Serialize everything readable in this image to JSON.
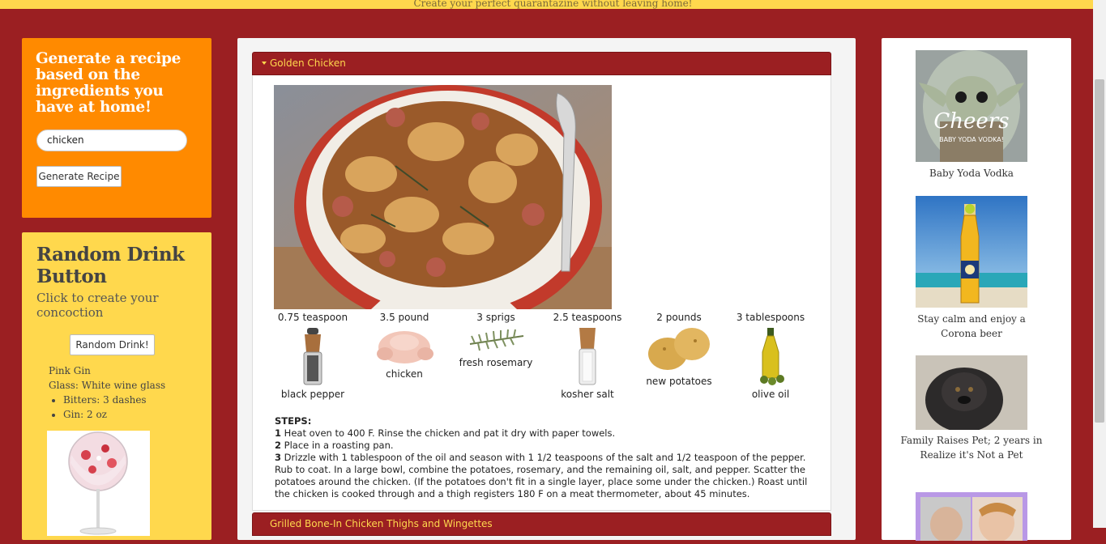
{
  "banner": {
    "tagline": "Create your perfect quarantazine without leaving home!"
  },
  "generator": {
    "title": "Generate a recipe based on the ingredients you have at home!",
    "input_value": "chicken",
    "button_label": "Generate Recipe"
  },
  "random_drink": {
    "title": "Random Drink Button",
    "subtitle": "Click to create your concoction",
    "button_label": "Random Drink!",
    "drink_name": "Pink Gin",
    "glass": "Glass: White wine glass",
    "ingredients": [
      "Bitters: 3 dashes",
      "Gin: 2 oz"
    ]
  },
  "recipes": [
    {
      "title": "Golden Chicken",
      "expanded": true,
      "ingredients": [
        {
          "qty": "0.75 teaspoon",
          "name": "black pepper",
          "icon": "pepper-grinder-icon"
        },
        {
          "qty": "3.5 pound",
          "name": "chicken",
          "icon": "raw-chicken-icon"
        },
        {
          "qty": "3 sprigs",
          "name": "fresh rosemary",
          "icon": "rosemary-icon"
        },
        {
          "qty": "2.5 teaspoons",
          "name": "kosher salt",
          "icon": "salt-grinder-icon"
        },
        {
          "qty": "2 pounds",
          "name": "new potatoes",
          "icon": "potatoes-icon"
        },
        {
          "qty": "3 tablespoons",
          "name": "olive oil",
          "icon": "olive-oil-bottle-icon"
        }
      ],
      "steps_label": "STEPS:",
      "steps": [
        {
          "n": "1",
          "text": " Heat oven to 400 F. Rinse the chicken and pat it dry with paper towels."
        },
        {
          "n": "2",
          "text": " Place in a roasting pan."
        },
        {
          "n": "3",
          "text": " Drizzle with 1 tablespoon of the oil and season with 1 1/2 teaspoons of the salt and 1/2 teaspoon of the pepper. Rub to coat. In a large bowl, combine the potatoes, rosemary, and the remaining oil, salt, and pepper. Scatter the potatoes around the chicken. (If the potatoes don't fit in a single layer, place some under the chicken.) Roast until the chicken is cooked through and a thigh registers 180 F on a meat thermometer, about 45 minutes."
        }
      ]
    },
    {
      "title": "Grilled Bone-In Chicken Thighs and Wingettes",
      "expanded": false
    }
  ],
  "ads": [
    {
      "caption": "Baby Yoda Vodka",
      "overlay_title": "Cheers",
      "overlay_sub": "BABY YODA VODKA!"
    },
    {
      "caption": "Stay calm and enjoy a Corona beer"
    },
    {
      "caption": "Family Raises Pet; 2 years in Realize it's Not a Pet"
    }
  ],
  "colors": {
    "page_bg": "#9b1f22",
    "accent_yellow": "#ffd84d",
    "accent_orange": "#ff8a00"
  }
}
